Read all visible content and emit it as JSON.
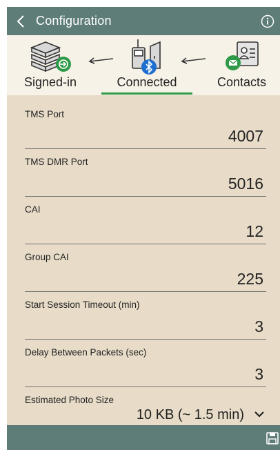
{
  "header": {
    "title": "Configuration",
    "back_icon": "chevron-left-icon",
    "info_icon": "info-icon",
    "color": "#5e7c78"
  },
  "steps": [
    {
      "label": "Signed-in",
      "icon": "server-login-icon",
      "active": false
    },
    {
      "label": "Connected",
      "icon": "radio-bluetooth-icon",
      "active": true
    },
    {
      "label": "Contacts",
      "icon": "contact-card-mail-icon",
      "active": false
    }
  ],
  "fields": [
    {
      "label": "TMS Port",
      "value": "4007"
    },
    {
      "label": "TMS DMR Port",
      "value": "5016"
    },
    {
      "label": "CAI",
      "value": "12"
    },
    {
      "label": "Group CAI",
      "value": "225"
    },
    {
      "label": "Start Session Timeout (min)",
      "value": "3"
    },
    {
      "label": "Delay Between Packets (sec)",
      "value": "3"
    },
    {
      "label": "Estimated Photo Size",
      "value": "10 KB (~ 1.5 min)"
    }
  ],
  "footer": {
    "save_icon": "save-icon"
  },
  "colors": {
    "accent": "#2e9a47",
    "bluetooth": "#1f6fd1",
    "form_bg": "#e8dcc8",
    "steps_bg": "#f7f2e8"
  }
}
